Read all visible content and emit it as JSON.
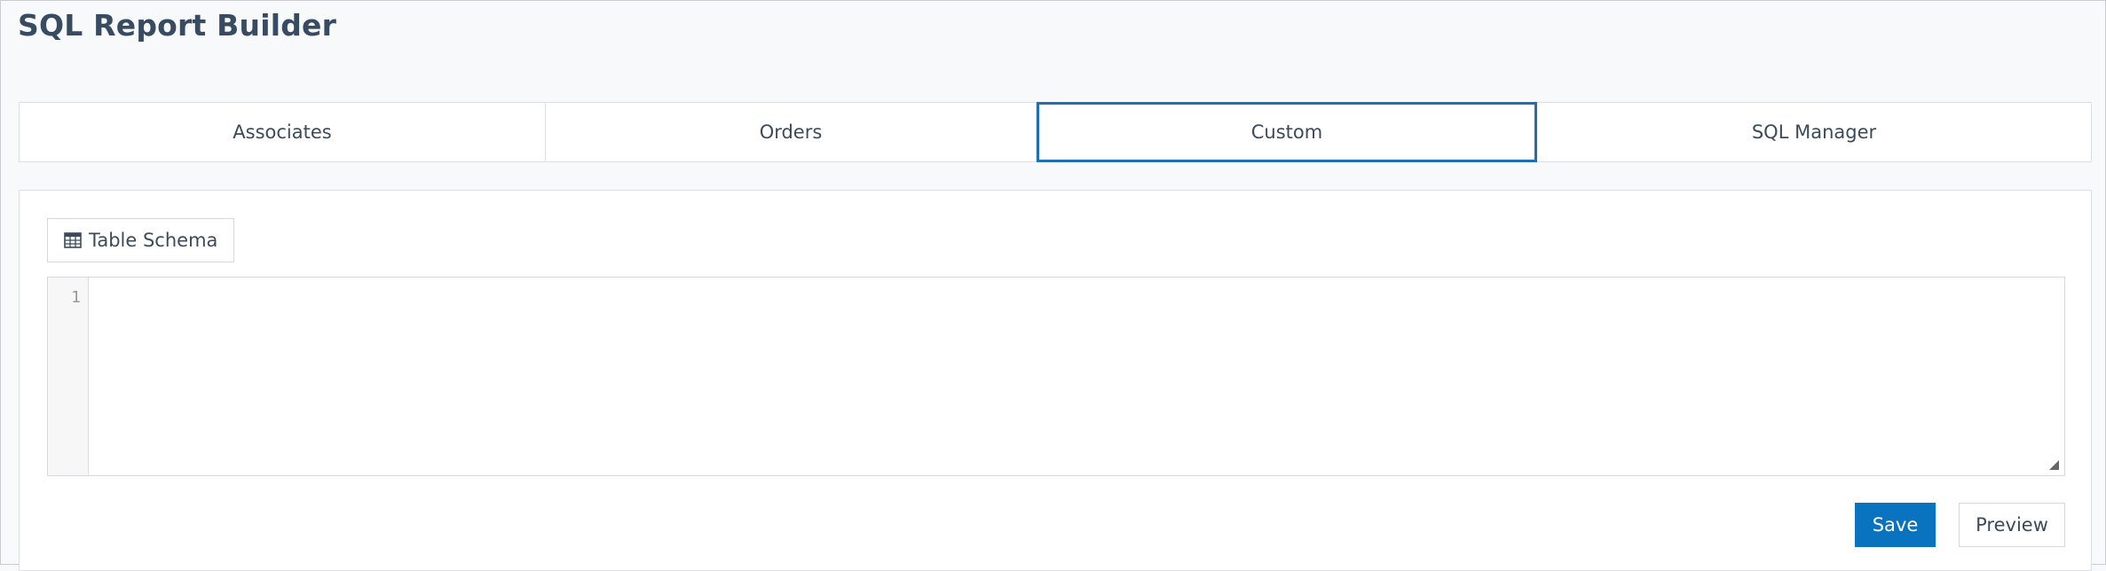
{
  "page": {
    "title": "SQL Report Builder"
  },
  "tabs": [
    {
      "label": "Associates",
      "active": false
    },
    {
      "label": "Orders",
      "active": false
    },
    {
      "label": "Custom",
      "active": true
    },
    {
      "label": "SQL Manager",
      "active": false
    }
  ],
  "panel": {
    "schema_button": {
      "label": "Table Schema",
      "icon": "table-icon"
    },
    "editor": {
      "line_numbers": [
        "1"
      ],
      "content": ""
    },
    "actions": {
      "save_label": "Save",
      "preview_label": "Preview"
    }
  },
  "colors": {
    "accent": "#0a73c0",
    "active_tab_border": "#1f6fb2",
    "title_text": "#374b62"
  }
}
